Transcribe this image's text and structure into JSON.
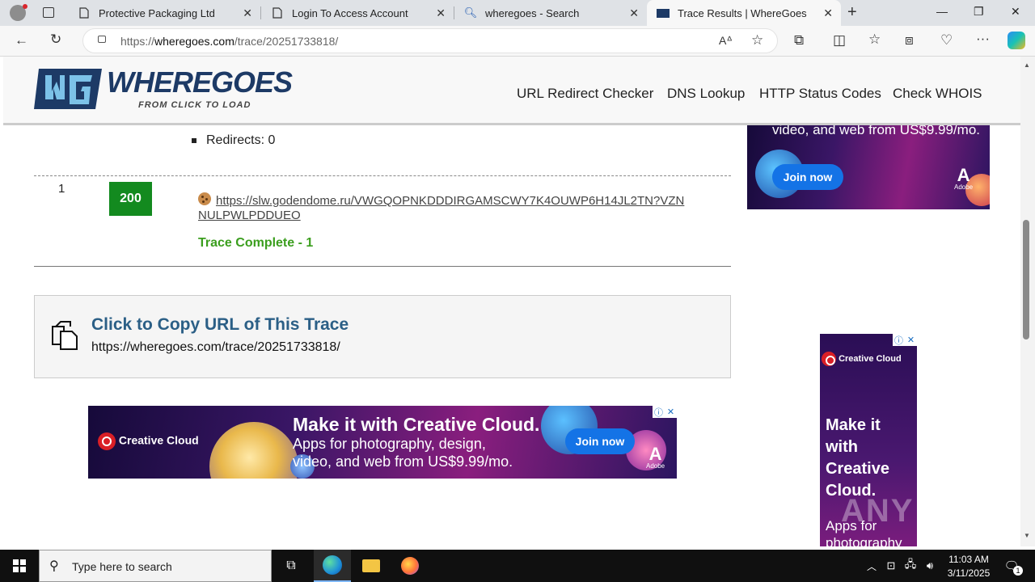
{
  "browser": {
    "tabs": [
      {
        "title": "Protective Packaging Ltd",
        "icon": "page-icon"
      },
      {
        "title": "Login To Access Account",
        "icon": "page-icon"
      },
      {
        "title": "wheregoes - Search",
        "icon": "search-icon"
      },
      {
        "title": "Trace Results | WhereGoes",
        "icon": "wheregoes-logo-icon",
        "active": true
      }
    ],
    "url_prefix": "https://",
    "url_domain": "wheregoes.com",
    "url_path": "/trace/20251733818/"
  },
  "site": {
    "logo_name": "WHEREGOES",
    "logo_tagline": "FROM CLICK TO LOAD",
    "nav": [
      "URL Redirect Checker",
      "DNS Lookup",
      "HTTP Status Codes",
      "Check WHOIS"
    ]
  },
  "trace": {
    "redirects_text": "Redirects: 0",
    "step_number": "1",
    "status_code": "200",
    "url": "https://slw.godendome.ru/VWGQOPNKDDDIRGAMSCWY7K4OUWP6H14JL2TN?VZNNULPWLPDDUEO",
    "complete_text": "Trace Complete - 1",
    "status_color": "#138a1f"
  },
  "copy": {
    "title": "Click to Copy URL of This Trace",
    "url": "https://wheregoes.com/trace/20251733818/"
  },
  "ads": {
    "top_right": {
      "text": "video, and web from US$9.99/mo.",
      "button": "Join now",
      "brand": "Adobe"
    },
    "banner": {
      "brand": "Creative Cloud",
      "headline": "Make it with Creative Cloud.",
      "line1": "Apps for photography, design,",
      "line2": "video, and web from US$9.99/mo.",
      "button": "Join now",
      "adobe": "Adobe"
    },
    "side": {
      "brand": "Creative Cloud",
      "headline": "Make it with Creative Cloud.",
      "line1": "Apps for",
      "line2": "photography"
    }
  },
  "taskbar": {
    "search_placeholder": "Type here to search",
    "time": "11:03 AM",
    "date": "3/11/2025",
    "notification_count": "1"
  },
  "watermark": "ANY RUN"
}
